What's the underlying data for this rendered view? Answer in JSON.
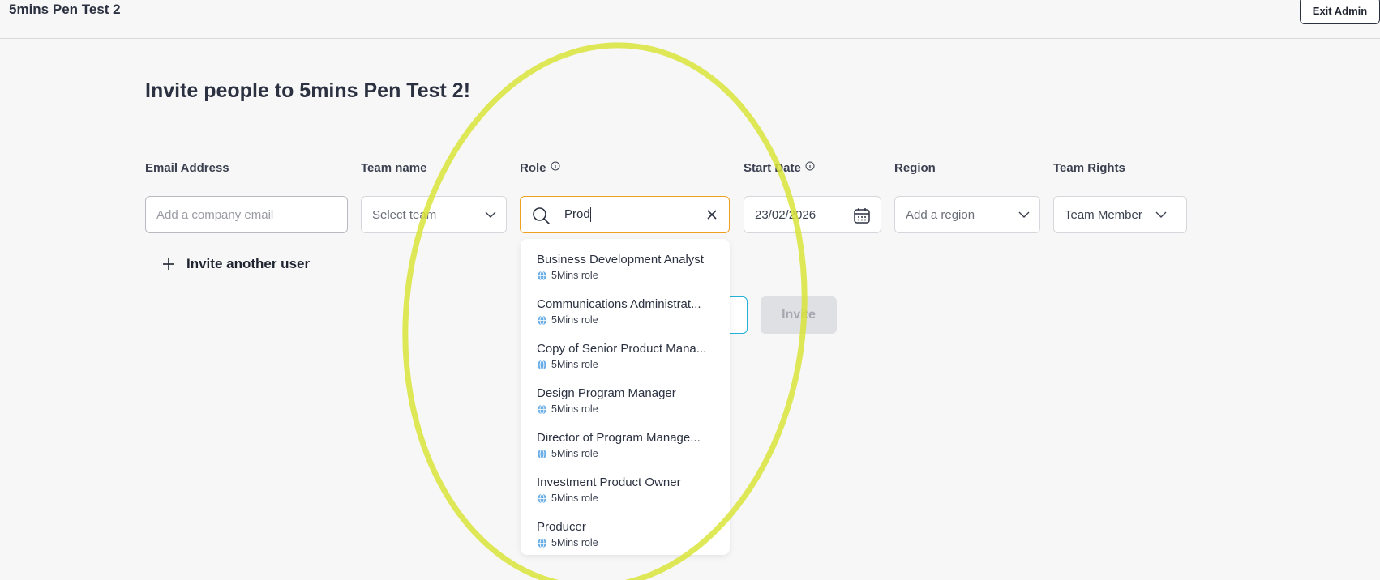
{
  "header": {
    "title": "5mins Pen Test 2",
    "exit_label": "Exit Admin"
  },
  "heading": "Invite people to 5mins Pen Test 2!",
  "columns": {
    "email": "Email Address",
    "team": "Team name",
    "role": "Role",
    "start": "Start Date",
    "region": "Region",
    "rights": "Team Rights"
  },
  "fields": {
    "email_placeholder": "Add a company email",
    "team_placeholder": "Select team",
    "role_query": "Prod",
    "start_date": "23/02/2026",
    "region_placeholder": "Add a region",
    "rights_value": "Team Member"
  },
  "invite_another": "Invite another user",
  "invite_button": "Invite",
  "role_options": [
    {
      "name": "Business Development Analyst",
      "tag": "5Mins role"
    },
    {
      "name": "Communications Administrat...",
      "tag": "5Mins role"
    },
    {
      "name": "Copy of Senior Product Mana...",
      "tag": "5Mins role"
    },
    {
      "name": "Design Program Manager",
      "tag": "5Mins role"
    },
    {
      "name": "Director of Program Manage...",
      "tag": "5Mins role"
    },
    {
      "name": "Investment Product Owner",
      "tag": "5Mins role"
    },
    {
      "name": "Producer",
      "tag": "5Mins role"
    }
  ],
  "colors": {
    "highlight": "#d9e43a",
    "focus": "#f0a020",
    "accent": "#22b0d6"
  }
}
